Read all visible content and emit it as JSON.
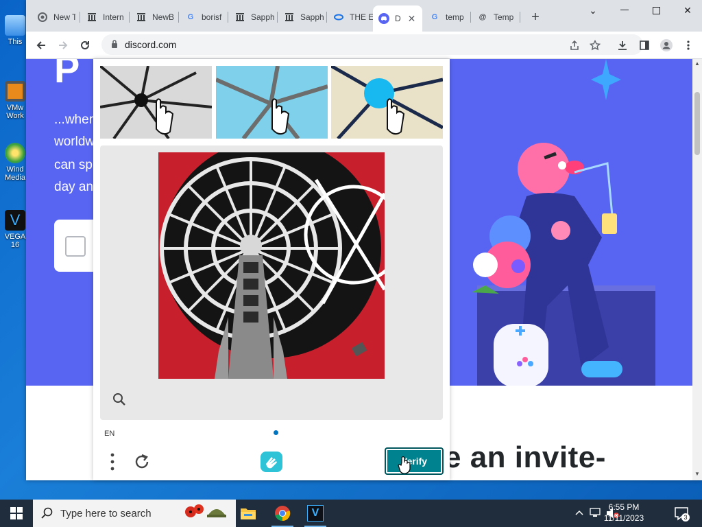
{
  "desktop": {
    "icons": [
      {
        "label": "This"
      },
      {
        "label": "VMw Work"
      },
      {
        "label": "Wind Media"
      },
      {
        "label": "VEGA 16"
      }
    ]
  },
  "browser": {
    "tabs": [
      {
        "label": "New T",
        "icon": "chrome-icon"
      },
      {
        "label": "Intern",
        "icon": "archive-icon"
      },
      {
        "label": "NewB",
        "icon": "archive-icon"
      },
      {
        "label": "borisf",
        "icon": "google-icon"
      },
      {
        "label": "Sapph",
        "icon": "archive-icon"
      },
      {
        "label": "Sapph",
        "icon": "archive-icon"
      },
      {
        "label": "THE E",
        "icon": "swirl-icon"
      },
      {
        "label": "D",
        "icon": "discord-icon",
        "active": true
      },
      {
        "label": "temp",
        "icon": "google-icon"
      },
      {
        "label": "Temp",
        "icon": "at-icon"
      }
    ],
    "new_tab": "+",
    "url": "discord.com"
  },
  "page": {
    "hero_title": "P",
    "hero_lines": [
      "...wher",
      "worldw",
      "can sp",
      "day an"
    ],
    "invite_text": "e an invite-"
  },
  "captcha": {
    "language": "EN",
    "verify_label": "Verify"
  },
  "taskbar": {
    "search_placeholder": "Type here to search",
    "time": "6:55 PM",
    "date": "11/11/2023",
    "notification_count": "3"
  },
  "colors": {
    "discord_blurple": "#5865f2",
    "verify_teal": "#00838f",
    "taskbar": "#1f2d3d"
  }
}
